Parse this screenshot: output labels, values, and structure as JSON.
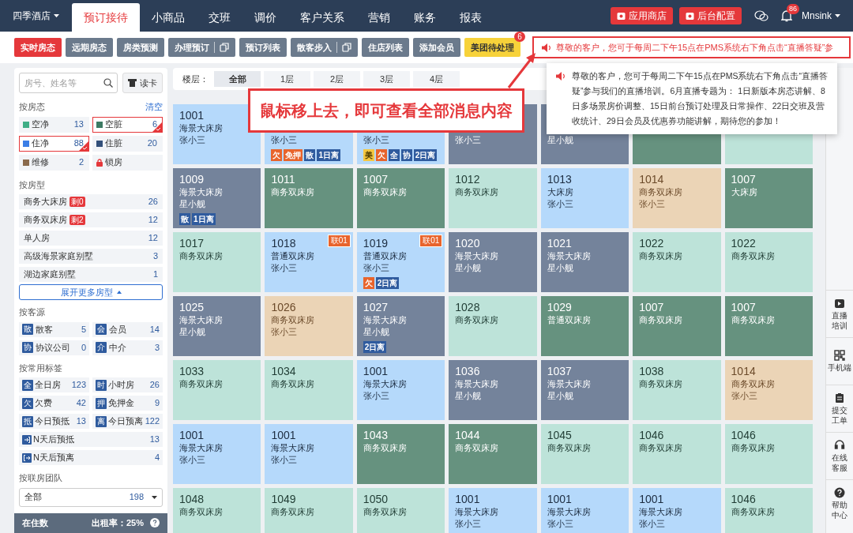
{
  "nav": {
    "hotel": "四季酒店",
    "tabs": [
      {
        "label": "预订接待",
        "selected": true
      },
      {
        "label": "小商品",
        "selected": false
      },
      {
        "label": "交班",
        "selected": false
      },
      {
        "label": "调价",
        "selected": false
      },
      {
        "label": "客户关系",
        "selected": false
      },
      {
        "label": "营销",
        "selected": false
      },
      {
        "label": "账务",
        "selected": false
      },
      {
        "label": "报表",
        "selected": false
      }
    ],
    "buttons": [
      "应用商店",
      "后台配置"
    ],
    "bell_badge": "86",
    "user": "Mnsink"
  },
  "toolbar": {
    "buttons": [
      {
        "label": "实时房态",
        "selected": true,
        "kind": "plain"
      },
      {
        "label": "远期房态",
        "selected": false,
        "kind": "plain"
      },
      {
        "label": "房类预测",
        "selected": false,
        "kind": "plain"
      },
      {
        "label": "办理预订",
        "selected": false,
        "kind": "split"
      },
      {
        "label": "预订列表",
        "selected": false,
        "kind": "plain"
      },
      {
        "label": "散客步入",
        "selected": false,
        "kind": "split"
      },
      {
        "label": "住店列表",
        "selected": false,
        "kind": "plain"
      },
      {
        "label": "添加会员",
        "selected": false,
        "kind": "plain"
      },
      {
        "label": "美团待处理",
        "selected": false,
        "kind": "highlight",
        "badge": "6"
      }
    ],
    "notice": "尊敬的客户，您可于每周二下午15点在PMS系统右下角点击“直播答疑”参"
  },
  "popover": {
    "text": "尊敬的客户，您可于每周二下午15点在PMS系统右下角点击“直播答疑”参与我们的直播培训。6月直播专题为： 1日新版本房态讲解、8日多场景房价调整、15日前台预订处理及日常操作、22日交班及营收统计、29日会员及优惠券功能讲解，期待您的参加！"
  },
  "callout": {
    "text": "鼠标移上去，即可查看全部消息内容"
  },
  "sidebar": {
    "search": {
      "placeholder": "房号、姓名等"
    },
    "card_button": "读卡",
    "status_title": "按房态",
    "clear": "清空",
    "statuses": [
      {
        "kind": "swatch",
        "label": "空净",
        "count": "13",
        "color": "#3fae86",
        "selected": false
      },
      {
        "kind": "swatch",
        "label": "空脏",
        "count": "6",
        "color": "#3d7a63",
        "selected": true
      },
      {
        "kind": "swatch",
        "label": "住净",
        "count": "88",
        "color": "#3b7ee6",
        "selected": true
      },
      {
        "kind": "swatch",
        "label": "住脏",
        "count": "20",
        "color": "#33507a",
        "selected": false
      },
      {
        "kind": "swatch",
        "label": "维修",
        "count": "2",
        "color": "#8a6a4c",
        "selected": false
      },
      {
        "kind": "lock",
        "label": "锁房",
        "selected": false
      }
    ],
    "type_title": "按房型",
    "room_types": [
      {
        "label": "商务大床房",
        "remaining": "剩0",
        "count": "26"
      },
      {
        "label": "商务双床房",
        "remaining": "剩2",
        "count": "12"
      },
      {
        "label": "单人房",
        "count": "12"
      },
      {
        "label": "高级海景家庭别墅",
        "count": "3"
      },
      {
        "label": "湖边家庭别墅",
        "count": "1"
      }
    ],
    "expand": "展开更多房型",
    "source_title": "按客源",
    "sources": [
      {
        "icon_text": "散",
        "label": "散客",
        "count": "5"
      },
      {
        "icon_text": "会",
        "label": "会员",
        "count": "14"
      },
      {
        "icon_text": "协",
        "label": "协议公司",
        "count": "0"
      },
      {
        "icon_text": "介",
        "label": "中介",
        "count": "3"
      }
    ],
    "tag_title": "按常用标签",
    "tags": [
      {
        "kind": "letter",
        "icon_text": "全",
        "label": "全日房",
        "count": "123"
      },
      {
        "kind": "letter",
        "icon_text": "时",
        "label": "小时房",
        "count": "26"
      },
      {
        "kind": "letter",
        "icon_text": "欠",
        "label": "欠费",
        "count": "42"
      },
      {
        "kind": "letter",
        "icon_text": "押",
        "label": "免押金",
        "count": "9"
      },
      {
        "kind": "letter",
        "icon_text": "抵",
        "label": "今日预抵",
        "count": "13"
      },
      {
        "kind": "letter",
        "icon_text": "离",
        "label": "今日预离",
        "count": "122"
      },
      {
        "kind": "checkin",
        "label": "N天后预抵",
        "count": "13"
      },
      {
        "kind": "checkout",
        "label": "N天后预离",
        "count": "4"
      }
    ],
    "team_title": "按联房团队",
    "team_select": {
      "value": "全部",
      "count": "198"
    },
    "status_bar": [
      "在住数",
      "出租率：25%"
    ]
  },
  "floors": {
    "label": "楼层：",
    "items": [
      {
        "label": "全部",
        "selected": true
      },
      {
        "label": "1层",
        "selected": false
      },
      {
        "label": "2层",
        "selected": false
      },
      {
        "label": "3层",
        "selected": false
      },
      {
        "label": "4层",
        "selected": false
      }
    ]
  },
  "rooms": [
    {
      "number": "1001",
      "type": "海景大床房",
      "guest": "张小三",
      "kind": "occupied_clean"
    },
    {
      "guest": "张小三",
      "kind": "occupied_clean",
      "tags": [
        {
          "text": "欠",
          "color": "#e8642c"
        },
        {
          "text": "免押",
          "color": "#e8642c"
        },
        {
          "text": "散",
          "color": "#2f5b9e"
        },
        {
          "text": "1日离",
          "color": "#2f5b9e"
        }
      ]
    },
    {
      "guest": "张小三",
      "kind": "occupied_clean",
      "tags": [
        {
          "text": "美",
          "color": "#f5c842"
        },
        {
          "text": "欠",
          "color": "#e8642c"
        },
        {
          "text": "全",
          "color": "#2f5b9e"
        },
        {
          "text": "协",
          "color": "#2f5b9e"
        },
        {
          "text": "2日离",
          "color": "#2f5b9e"
        }
      ]
    },
    {
      "guest": "张小三",
      "kind": "occupied_dirty"
    },
    {
      "guest": "星小舰",
      "kind": "occupied_dirty"
    },
    {
      "kind": "vacant_dirty"
    },
    {
      "kind": "vacant_clean"
    },
    {
      "number": "1009",
      "type": "海景大床房",
      "guest": "星小舰",
      "kind": "occupied_dirty",
      "tags": [
        {
          "text": "散",
          "color": "#2f5b9e"
        },
        {
          "text": "1日离",
          "color": "#2f5b9e"
        }
      ]
    },
    {
      "number": "1011",
      "type": "商务双床房",
      "kind": "vacant_dirty"
    },
    {
      "number": "1007",
      "type": "商务双床房",
      "kind": "vacant_dirty"
    },
    {
      "number": "1012",
      "type": "商务双床房",
      "kind": "vacant_clean"
    },
    {
      "number": "1013",
      "type": "大床房",
      "guest": "张小三",
      "kind": "occupied_clean"
    },
    {
      "number": "1014",
      "type": "商务双床房",
      "guest": "张小三",
      "kind": "maintenance"
    },
    {
      "number": "1007",
      "type": "大床房",
      "kind": "vacant_dirty"
    },
    {
      "number": "1017",
      "type": "商务双床房",
      "kind": "vacant_clean"
    },
    {
      "number": "1018",
      "type": "普通双床房",
      "guest": "张小三",
      "kind": "occupied_clean",
      "badge": "联01"
    },
    {
      "number": "1019",
      "type": "普通双床房",
      "guest": "张小三",
      "kind": "occupied_clean",
      "badge": "联01",
      "tags": [
        {
          "text": "欠",
          "color": "#e8642c"
        },
        {
          "text": "2日离",
          "color": "#2f5b9e"
        }
      ]
    },
    {
      "number": "1020",
      "type": "海景大床房",
      "guest": "星小舰",
      "kind": "occupied_dirty"
    },
    {
      "number": "1021",
      "type": "海景大床房",
      "guest": "星小舰",
      "kind": "occupied_dirty"
    },
    {
      "number": "1022",
      "type": "商务双床房",
      "kind": "vacant_clean"
    },
    {
      "number": "1022",
      "type": "商务双床房",
      "kind": "vacant_clean"
    },
    {
      "number": "1025",
      "type": "海景大床房",
      "guest": "星小舰",
      "kind": "occupied_dirty"
    },
    {
      "number": "1026",
      "type": "商务双床房",
      "guest": "张小三",
      "kind": "maintenance"
    },
    {
      "number": "1027",
      "type": "海景大床房",
      "guest": "星小舰",
      "kind": "occupied_dirty",
      "tags": [
        {
          "text": "2日离",
          "color": "#2f5b9e"
        }
      ]
    },
    {
      "number": "1028",
      "type": "商务双床房",
      "kind": "vacant_clean"
    },
    {
      "number": "1029",
      "type": "普通双床房",
      "kind": "vacant_dirty"
    },
    {
      "number": "1007",
      "type": "商务双床房",
      "kind": "vacant_dirty"
    },
    {
      "number": "1007",
      "type": "商务双床房",
      "kind": "vacant_dirty"
    },
    {
      "number": "1033",
      "type": "商务双床房",
      "kind": "vacant_clean"
    },
    {
      "number": "1034",
      "type": "商务双床房",
      "kind": "vacant_clean"
    },
    {
      "number": "1001",
      "type": "海景大床房",
      "guest": "张小三",
      "kind": "occupied_clean"
    },
    {
      "number": "1036",
      "type": "海景大床房",
      "guest": "星小舰",
      "kind": "occupied_dirty"
    },
    {
      "number": "1037",
      "type": "海景大床房",
      "guest": "星小舰",
      "kind": "occupied_dirty"
    },
    {
      "number": "1038",
      "type": "商务双床房",
      "kind": "vacant_clean"
    },
    {
      "number": "1014",
      "type": "商务双床房",
      "guest": "张小三",
      "kind": "maintenance"
    },
    {
      "number": "1001",
      "type": "海景大床房",
      "guest": "张小三",
      "kind": "occupied_clean"
    },
    {
      "number": "1001",
      "type": "海景大床房",
      "guest": "张小三",
      "kind": "occupied_clean"
    },
    {
      "number": "1043",
      "type": "商务双床房",
      "kind": "vacant_dirty"
    },
    {
      "number": "1044",
      "type": "商务双床房",
      "kind": "vacant_dirty"
    },
    {
      "number": "1045",
      "type": "商务双床房",
      "kind": "vacant_clean"
    },
    {
      "number": "1046",
      "type": "商务双床房",
      "kind": "vacant_clean"
    },
    {
      "number": "1046",
      "type": "商务双床房",
      "kind": "vacant_clean"
    },
    {
      "number": "1048",
      "type": "商务双床房",
      "kind": "vacant_clean"
    },
    {
      "number": "1049",
      "type": "商务双床房",
      "kind": "vacant_clean"
    },
    {
      "number": "1050",
      "type": "商务双床房",
      "kind": "vacant_clean"
    },
    {
      "number": "1001",
      "type": "海景大床房",
      "guest": "张小三",
      "kind": "occupied_clean"
    },
    {
      "number": "1001",
      "type": "海景大床房",
      "guest": "张小三",
      "kind": "occupied_clean"
    },
    {
      "number": "1001",
      "type": "海景大床房",
      "guest": "张小三",
      "kind": "occupied_clean"
    },
    {
      "number": "1046",
      "type": "商务双床房",
      "kind": "vacant_clean"
    }
  ],
  "rail": [
    {
      "kind": "play",
      "label": "直播培训"
    },
    {
      "kind": "qr",
      "label": "手机端"
    },
    {
      "kind": "ticket",
      "label": "提交工单"
    },
    {
      "kind": "service",
      "label": "在线客服"
    },
    {
      "kind": "help",
      "label": "帮助中心"
    }
  ]
}
